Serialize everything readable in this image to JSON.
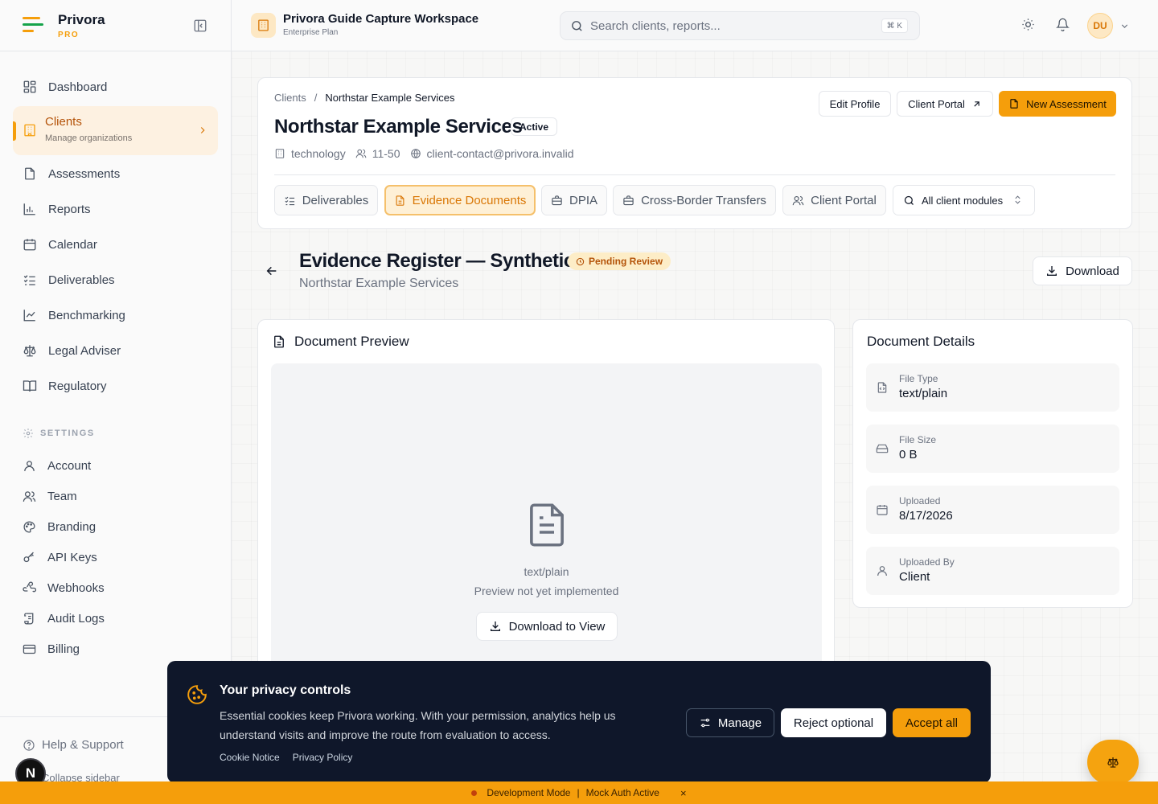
{
  "brand": {
    "name": "Privora",
    "tier": "PRO"
  },
  "workspace": {
    "title": "Privora Guide Capture Workspace",
    "plan": "Enterprise Plan"
  },
  "search": {
    "placeholder": "Search clients, reports...",
    "shortcut": "⌘ K"
  },
  "user": {
    "initials": "DU"
  },
  "sidebar": {
    "items": [
      {
        "label": "Dashboard",
        "icon": "dashboard-icon"
      },
      {
        "label": "Clients",
        "sub": "Manage organizations",
        "icon": "building-icon",
        "active": true
      },
      {
        "label": "Assessments",
        "icon": "file-icon"
      },
      {
        "label": "Reports",
        "icon": "bar-chart-icon"
      },
      {
        "label": "Calendar",
        "icon": "calendar-icon"
      },
      {
        "label": "Deliverables",
        "icon": "list-check-icon"
      },
      {
        "label": "Benchmarking",
        "icon": "line-chart-icon"
      },
      {
        "label": "Legal Adviser",
        "icon": "scale-icon"
      },
      {
        "label": "Regulatory",
        "icon": "book-icon"
      }
    ],
    "settings_heading": "SETTINGS",
    "settings": [
      {
        "label": "Account",
        "icon": "user-icon"
      },
      {
        "label": "Team",
        "icon": "users-icon"
      },
      {
        "label": "Branding",
        "icon": "palette-icon"
      },
      {
        "label": "API Keys",
        "icon": "key-icon"
      },
      {
        "label": "Webhooks",
        "icon": "webhook-icon"
      },
      {
        "label": "Audit Logs",
        "icon": "scroll-icon"
      },
      {
        "label": "Billing",
        "icon": "credit-card-icon"
      }
    ],
    "help": "Help & Support",
    "collapse": "Collapse sidebar",
    "avatar_letter": "N"
  },
  "client": {
    "breadcrumb_root": "Clients",
    "breadcrumb_sep": "/",
    "breadcrumb_current": "Northstar Example Services",
    "name": "Northstar Example Services",
    "status": "Active",
    "industry": "technology",
    "size": "11-50",
    "email": "client-contact@privora.invalid",
    "buttons": {
      "edit": "Edit Profile",
      "portal": "Client Portal",
      "new": "New Assessment"
    },
    "tabs": [
      {
        "label": "Deliverables",
        "icon": "list-check-icon"
      },
      {
        "label": "Evidence Documents",
        "icon": "file-text-icon",
        "active": true
      },
      {
        "label": "DPIA",
        "icon": "briefcase-icon"
      },
      {
        "label": "Cross-Border Transfers",
        "icon": "briefcase-icon"
      },
      {
        "label": "Client Portal",
        "icon": "users-icon"
      }
    ],
    "module_select": "All client modules"
  },
  "document": {
    "title": "Evidence Register — Synthetic",
    "status": "Pending Review",
    "client": "Northstar Example Services",
    "download": "Download"
  },
  "preview": {
    "heading": "Document Preview",
    "type": "text/plain",
    "message": "Preview not yet implemented",
    "download": "Download to View"
  },
  "details": {
    "heading": "Document Details",
    "rows": [
      {
        "label": "File Type",
        "value": "text/plain"
      },
      {
        "label": "File Size",
        "value": "0 B"
      },
      {
        "label": "Uploaded",
        "value": "8/17/2026"
      },
      {
        "label": "Uploaded By",
        "value": "Client"
      }
    ]
  },
  "cookie": {
    "title": "Your privacy controls",
    "text": "Essential cookies keep Privora working. With your permission, analytics help us understand visits and improve the route from evaluation to access.",
    "notice": "Cookie Notice",
    "policy": "Privacy Policy",
    "manage": "Manage",
    "reject": "Reject optional",
    "accept": "Accept all"
  },
  "devbar": {
    "mode": "Development Mode",
    "sep": "|",
    "auth": "Mock Auth Active",
    "close": "×"
  },
  "colors": {
    "accent": "#f59e0b",
    "dark": "#0f172a"
  }
}
